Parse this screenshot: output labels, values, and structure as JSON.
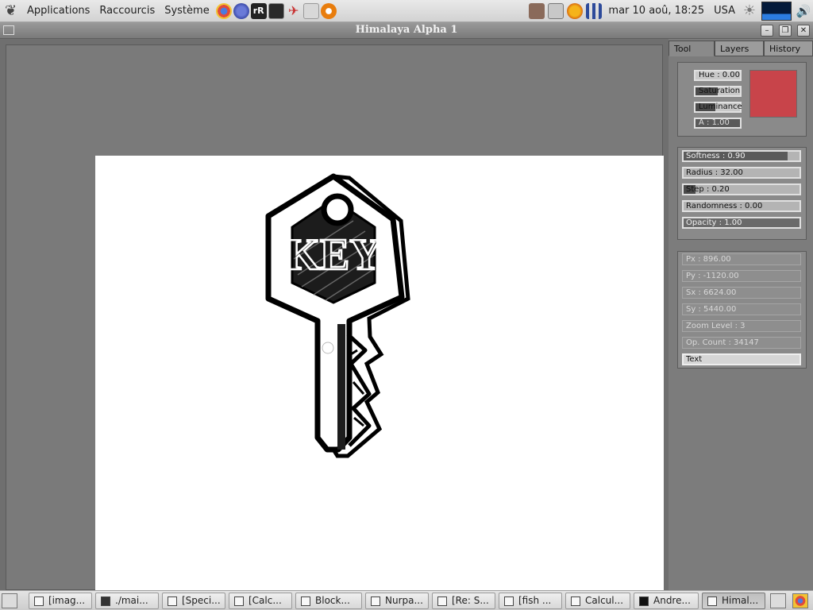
{
  "top_panel": {
    "menus": [
      "Applications",
      "Raccourcis",
      "Système"
    ],
    "clock": "mar 10 aoû, 18:25",
    "locale": "USA"
  },
  "window": {
    "title": "Himalaya Alpha 1"
  },
  "tabs": [
    "Tool",
    "Layers",
    "History"
  ],
  "color": {
    "hue": "Hue : 0.00",
    "saturation": "Saturation",
    "luminance": "Luminance",
    "alpha": "A : 1.00",
    "swatch": "#c8444a"
  },
  "brush": {
    "softness": "Softness : 0.90",
    "radius": "Radius : 32.00",
    "step": "Step : 0.20",
    "randomness": "Randomness : 0.00",
    "opacity": "Opacity : 1.00"
  },
  "info": {
    "px": "Px : 896.00",
    "py": "Py : -1120.00",
    "sx": "Sx : 6624.00",
    "sy": "Sy : 5440.00",
    "zoom": "Zoom Level : 3",
    "op_count": "Op. Count : 34147",
    "text_button": "Text"
  },
  "drawing": {
    "key_label": "KEY"
  },
  "taskbar": [
    "[imag...",
    "./mai...",
    "[Speci...",
    "[Calc...",
    "Block...",
    "Nurpa...",
    "[Re: S...",
    "[fish ...",
    "Calcul...",
    "Andre...",
    "Himal..."
  ]
}
